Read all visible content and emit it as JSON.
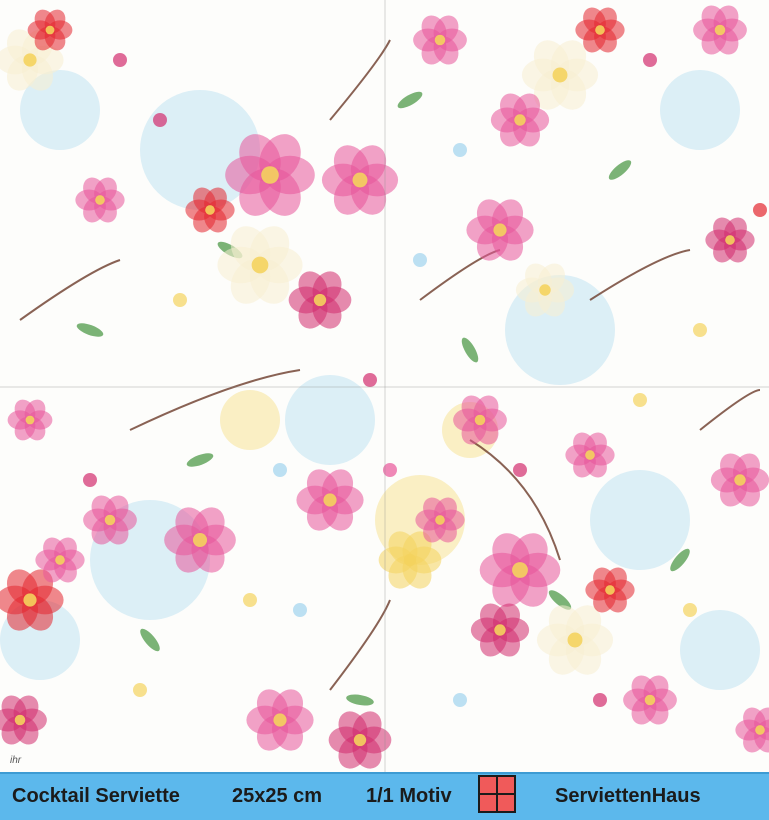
{
  "image": {
    "subject": "Floral watercolour paper napkin product photo",
    "palette": {
      "pink": "#e8559a",
      "magenta": "#d12c6e",
      "red": "#e3262f",
      "light_blue": "#9fd3ee",
      "yellow": "#f4d35e",
      "cream": "#f7efd2",
      "leaf_green": "#4f9a4a",
      "branch_brown": "#6b3b2a",
      "background": "#fdfdfb"
    }
  },
  "info_bar": {
    "product_name": "Cocktail Serviette",
    "size": "25x25 cm",
    "motif": "1/1 Motiv",
    "shop": "ServiettenHaus",
    "background_color": "#5cb8ec",
    "motif_icon": "four-squares-icon"
  }
}
